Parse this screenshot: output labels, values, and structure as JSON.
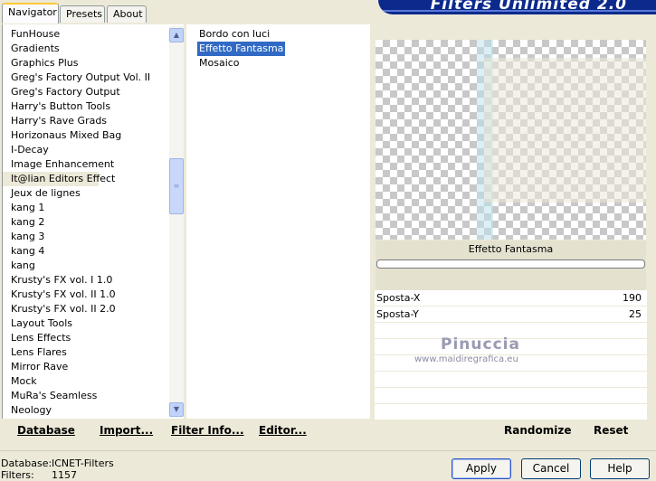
{
  "tabs": [
    {
      "label": "Navigator",
      "active": true
    },
    {
      "label": "Presets",
      "active": false
    },
    {
      "label": "About",
      "active": false
    }
  ],
  "banner_title": "Filters Unlimited 2.0",
  "categories": [
    "FunHouse",
    "Gradients",
    "Graphics Plus",
    "Greg's Factory Output Vol. II",
    "Greg's Factory Output",
    "Harry's Button Tools",
    "Harry's Rave Grads",
    "Horizonaus Mixed Bag",
    "I-Decay",
    "Image Enhancement",
    "It@lian Editors Effect",
    "Jeux de lignes",
    "kang 1",
    "kang 2",
    "kang 3",
    "kang 4",
    "kang",
    "Krusty's FX vol. I 1.0",
    "Krusty's FX vol. II 1.0",
    "Krusty's FX vol. II 2.0",
    "Layout Tools",
    "Lens Effects",
    "Lens Flares",
    "Mirror Rave",
    "Mock",
    "MuRa's Seamless",
    "Neology"
  ],
  "selected_category": "It@lian Editors Effect",
  "filters": [
    "Bordo con luci",
    "Effetto Fantasma",
    "Mosaico"
  ],
  "selected_filter": "Effetto Fantasma",
  "preview": {
    "filter_name": "Effetto Fantasma",
    "params": [
      {
        "label": "Sposta-X",
        "value": "190"
      },
      {
        "label": "Sposta-Y",
        "value": "25"
      }
    ]
  },
  "watermark": {
    "name": "Pinuccia",
    "site": "www.maidiregrafica.eu"
  },
  "toolbar": {
    "database": "Database",
    "import": "Import...",
    "filter_info": "Filter Info...",
    "editor": "Editor...",
    "randomize": "Randomize",
    "reset": "Reset"
  },
  "footer": {
    "database_label": "Database:",
    "database_value": "ICNET-Filters",
    "filters_label": "Filters:",
    "filters_value": "1157",
    "apply": "Apply",
    "cancel": "Cancel",
    "help": "Help"
  },
  "colors": {
    "selection": "#316ac5",
    "banner": "#0c2a8c",
    "face": "#ece9d8"
  },
  "scroll_position": 0.38
}
